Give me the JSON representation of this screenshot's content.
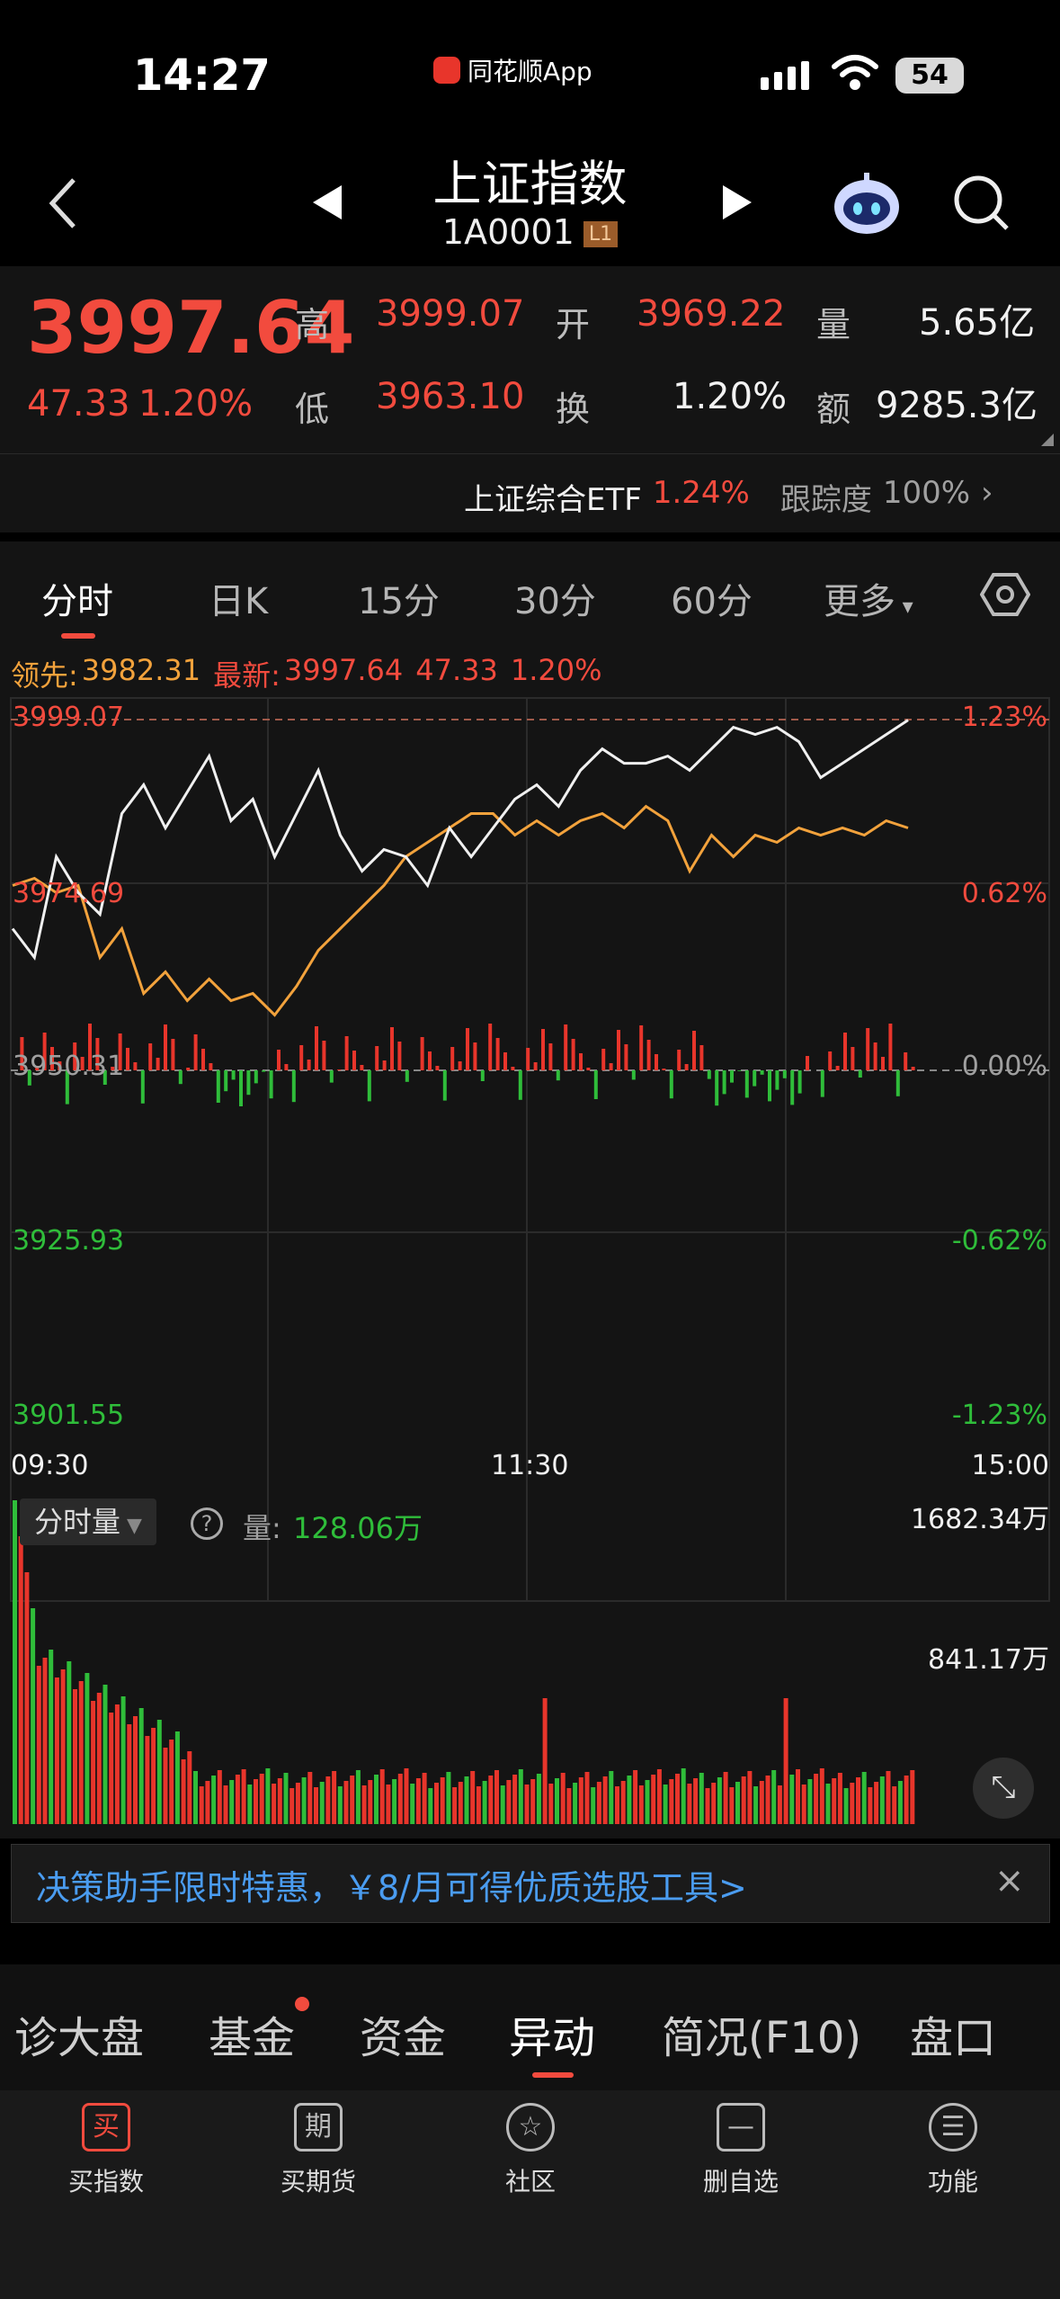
{
  "status": {
    "time": "14:27",
    "app": "同花顺App",
    "battery": "54"
  },
  "header": {
    "title": "上证指数",
    "code": "1A0001",
    "level": "L1"
  },
  "quote": {
    "price": "3997.64",
    "change": "47.33",
    "change_pct": "1.20%",
    "high_label": "高",
    "high": "3999.07",
    "open_label": "开",
    "open": "3969.22",
    "vol_label": "量",
    "vol": "5.65亿",
    "low_label": "低",
    "low": "3963.10",
    "turnover_label": "换",
    "turnover": "1.20%",
    "amount_label": "额",
    "amount": "9285.3亿"
  },
  "etf": {
    "name": "上证综合ETF",
    "pct": "1.24%",
    "track_label": "跟踪度",
    "track": "100%"
  },
  "tabs": [
    "分时",
    "日K",
    "15分",
    "30分",
    "60分",
    "更多"
  ],
  "chart_info": {
    "lead_label": "领先:",
    "lead": "3982.31",
    "latest_label": "最新:",
    "latest": "3997.64",
    "chg": "47.33",
    "pct": "1.20%"
  },
  "chart_data": {
    "type": "line",
    "y_left": [
      "3999.07",
      "3974.69",
      "3950.31",
      "3925.93",
      "3901.55"
    ],
    "y_right": [
      "1.23%",
      "0.62%",
      "0.00%",
      "-0.62%",
      "-1.23%"
    ],
    "x_ticks": [
      "09:30",
      "11:30",
      "15:00"
    ],
    "ylim": [
      3901.55,
      3999.07
    ],
    "series": [
      {
        "color": "#f0f0f0",
        "values": [
          3970,
          3966,
          3980,
          3975,
          3972,
          3986,
          3990,
          3984,
          3989,
          3994,
          3985,
          3988,
          3980,
          3986,
          3992,
          3983,
          3978,
          3981,
          3980,
          3976,
          3984,
          3980,
          3984,
          3988,
          3990,
          3987,
          3992,
          3995,
          3993,
          3993,
          3994,
          3992,
          3995,
          3998,
          3997,
          3998,
          3996,
          3991,
          3993,
          3995,
          3997,
          3999
        ]
      },
      {
        "color": "#f2a23c",
        "values": [
          3976,
          3977,
          3975,
          3976,
          3966,
          3970,
          3961,
          3964,
          3960,
          3963,
          3960,
          3961,
          3958,
          3962,
          3967,
          3970,
          3973,
          3976,
          3980,
          3982,
          3984,
          3986,
          3986,
          3983,
          3985,
          3983,
          3985,
          3986,
          3984,
          3987,
          3985,
          3978,
          3983,
          3980,
          3983,
          3982,
          3984,
          3983,
          3984,
          3983,
          3985,
          3984
        ]
      }
    ],
    "volume_header": {
      "label": "分时量",
      "vol_label": "量:",
      "vol": "128.06万",
      "max": "1682.34万",
      "mid": "841.17万"
    }
  },
  "banner": {
    "text": "决策助手限时特惠，￥8/月可得优质选股工具>"
  },
  "bottom_tabs": [
    "诊大盘",
    "基金",
    "资金",
    "异动",
    "简况(F10)",
    "盘口"
  ],
  "toolbar": [
    {
      "icon": "买",
      "label": "买指数"
    },
    {
      "icon": "期",
      "label": "买期货"
    },
    {
      "icon": "☆",
      "label": "社区"
    },
    {
      "icon": "—",
      "label": "删自选"
    },
    {
      "icon": "☰",
      "label": "功能"
    }
  ]
}
